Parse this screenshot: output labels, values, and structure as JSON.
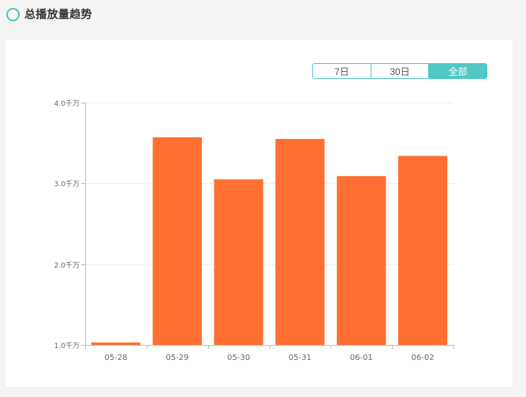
{
  "header": {
    "title": "总播放量趋势"
  },
  "filter": {
    "options": [
      {
        "label": "7日",
        "active": false
      },
      {
        "label": "30日",
        "active": false
      },
      {
        "label": "全部",
        "active": true
      }
    ]
  },
  "colors": {
    "accent": "#4fc8c6",
    "bar": "#ff6f31",
    "axis": "#bdbdbd",
    "grid": "#eeeeee",
    "label": "#666666"
  },
  "chart_data": {
    "type": "bar",
    "title": "",
    "xlabel": "",
    "ylabel": "",
    "categories": [
      "05-28",
      "05-29",
      "05-30",
      "05-31",
      "06-01",
      "06-02"
    ],
    "values": [
      1.03,
      3.57,
      3.05,
      3.55,
      3.09,
      3.34
    ],
    "unit": "千万",
    "ylim": [
      1,
      4
    ],
    "yticks": [
      1,
      2,
      3,
      4
    ],
    "ytick_labels": [
      "1.0千万",
      "2.0千万",
      "3.0千万",
      "4.0千万"
    ],
    "grid": true,
    "legend": "none"
  }
}
